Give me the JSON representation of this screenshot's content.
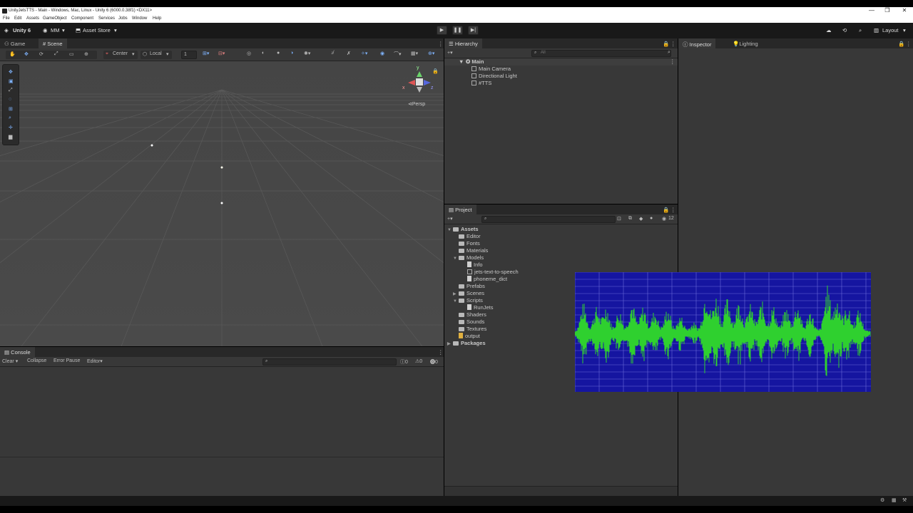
{
  "window": {
    "title": "UnityJetsTTS - Main - Windows, Mac, Linux - Unity 6 (6000.0.38f1) <DX11>",
    "controls": [
      "—",
      "❐",
      "✕"
    ]
  },
  "menu": [
    "File",
    "Edit",
    "Assets",
    "GameObject",
    "Component",
    "Services",
    "Jobs",
    "Window",
    "Help"
  ],
  "toolbar": {
    "product": "Unity 6",
    "account": "MM",
    "asset_store": "Asset Store",
    "layout": "Layout"
  },
  "scene": {
    "tabs": [
      "Game",
      "Scene"
    ],
    "pivot": "Center",
    "space": "Local",
    "grid_value": "1",
    "persp": "Persp",
    "gizmo_axes": [
      "y",
      "x",
      "z"
    ]
  },
  "hierarchy": {
    "title": "Hierarchy",
    "search_placeholder": "All",
    "scene_name": "Main",
    "objects": [
      "Main Camera",
      "Directional Light",
      "#TTS"
    ]
  },
  "inspector": {
    "tabs": [
      "Inspector",
      "Lighting"
    ]
  },
  "project": {
    "title": "Project",
    "count": "12",
    "root": "Assets",
    "items": [
      {
        "label": "Editor",
        "type": "folder",
        "depth": 1,
        "arrow": ""
      },
      {
        "label": "Fonts",
        "type": "folder",
        "depth": 1,
        "arrow": ""
      },
      {
        "label": "Materials",
        "type": "folder",
        "depth": 1,
        "arrow": ""
      },
      {
        "label": "Models",
        "type": "folder",
        "depth": 1,
        "arrow": "▼"
      },
      {
        "label": "Info",
        "type": "file",
        "depth": 2,
        "arrow": ""
      },
      {
        "label": "jets-text-to-speech",
        "type": "model",
        "depth": 2,
        "arrow": ""
      },
      {
        "label": "phoneme_dict",
        "type": "file",
        "depth": 2,
        "arrow": ""
      },
      {
        "label": "Prefabs",
        "type": "folder",
        "depth": 1,
        "arrow": ""
      },
      {
        "label": "Scenes",
        "type": "folder",
        "depth": 1,
        "arrow": "▶"
      },
      {
        "label": "Scripts",
        "type": "folder",
        "depth": 1,
        "arrow": "▼"
      },
      {
        "label": "RunJets",
        "type": "script",
        "depth": 2,
        "arrow": ""
      },
      {
        "label": "Shaders",
        "type": "folder",
        "depth": 1,
        "arrow": ""
      },
      {
        "label": "Sounds",
        "type": "folder",
        "depth": 1,
        "arrow": ""
      },
      {
        "label": "Textures",
        "type": "folder",
        "depth": 1,
        "arrow": ""
      },
      {
        "label": "output",
        "type": "audio",
        "depth": 1,
        "arrow": ""
      }
    ],
    "packages": "Packages"
  },
  "console": {
    "title": "Console",
    "clear": "Clear",
    "collapse": "Collapse",
    "error_pause": "Error Pause",
    "editor": "Editor",
    "counts": [
      "0",
      "0",
      "0"
    ]
  },
  "colors": {
    "panel": "#383838",
    "waveform_bg": "#1515a0",
    "waveform": "#2fd02f"
  }
}
